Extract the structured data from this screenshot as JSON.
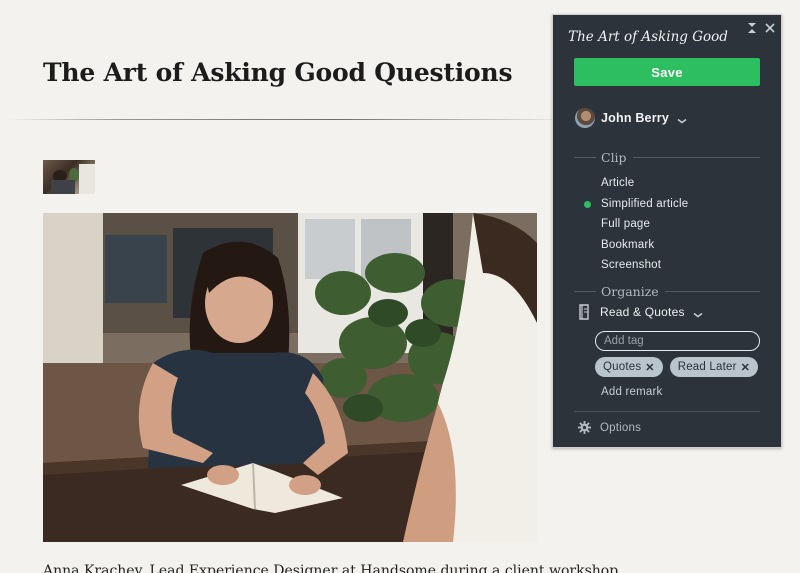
{
  "article": {
    "title": "The Art of Asking Good Questions",
    "caption": "Anna Krachey, Lead Experience Designer at Handsome during a client workshop"
  },
  "clipper": {
    "title": "The Art of Asking Good",
    "save_label": "Save",
    "account_name": "John Berry",
    "clip_section_label": "Clip",
    "clip_options": [
      {
        "label": "Article",
        "selected": false
      },
      {
        "label": "Simplified article",
        "selected": true
      },
      {
        "label": "Full page",
        "selected": false
      },
      {
        "label": "Bookmark",
        "selected": false
      },
      {
        "label": "Screenshot",
        "selected": false
      }
    ],
    "organize_section_label": "Organize",
    "notebook": "Read & Quotes",
    "tag_placeholder": "Add tag",
    "tags": [
      "Quotes",
      "Read Later"
    ],
    "add_remark_label": "Add remark",
    "options_label": "Options",
    "icons": {
      "collapse": "collapse-icon",
      "close": "close-icon",
      "account_chevron": "chevron-down-icon",
      "notebook": "notebook-icon",
      "notebook_chevron": "chevron-down-icon",
      "tag_remove": "close-icon",
      "options": "gear-icon"
    },
    "colors": {
      "accent": "#2dbe60",
      "panel_background": "#2c333a",
      "tag_background": "#b9c4cc"
    }
  }
}
